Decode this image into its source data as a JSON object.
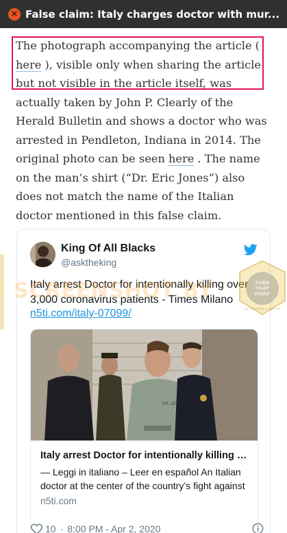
{
  "window": {
    "title": "False claim: Italy charges doctor with mur...",
    "close_glyph": "×"
  },
  "article": {
    "para_before_link1": "The photograph accompanying the article ( ",
    "link1": "here",
    "para_mid": " ), visible only when sharing the article but not visible in the article itself, was actually taken by John P. Clearly of the Herald Bulletin and shows a doctor who was arrested in Pendleton, Indiana in 2014. The original photo can be seen ",
    "link2": "here",
    "para_after": " . The name on the man’s shirt (“Dr. Eric Jones”) also does not match the name of the Italian doctor mentioned in this false claim."
  },
  "watermark": {
    "text": "SCREENSHOT BY",
    "badge_lines": [
      "TURN",
      "THAT",
      "HOAX"
    ],
    "badge_ring": "FACT-CHECKING & VERIFYING"
  },
  "tweet": {
    "display_name": "King Of All Blacks",
    "handle": "@asktheking",
    "text": "Italy arrest Doctor for intentionally killing over 3,000 coronavirus patients - Times Milano",
    "link": "n5ti.com/italy-07099/",
    "card": {
      "title": "Italy arrest Doctor for intentionally killing o...",
      "description": "— Leggi in italiano – Leer en español An Italian doctor at the center of the country’s fight against",
      "domain": "n5ti.com",
      "image_shirt_text": "DR. JONES"
    },
    "footer": {
      "likes": "10",
      "timestamp": "8:00 PM - Apr 2, 2020",
      "separator": "·"
    }
  },
  "icons": {
    "close": "close-icon",
    "twitter": "twitter-bird-icon",
    "heart": "heart-icon",
    "info": "info-icon"
  },
  "colors": {
    "titlebar": "#303030",
    "close_button": "#e95420",
    "highlight_border": "#e0125f",
    "twitter_blue": "#1da1f2",
    "link_blue": "#1b95e0"
  }
}
